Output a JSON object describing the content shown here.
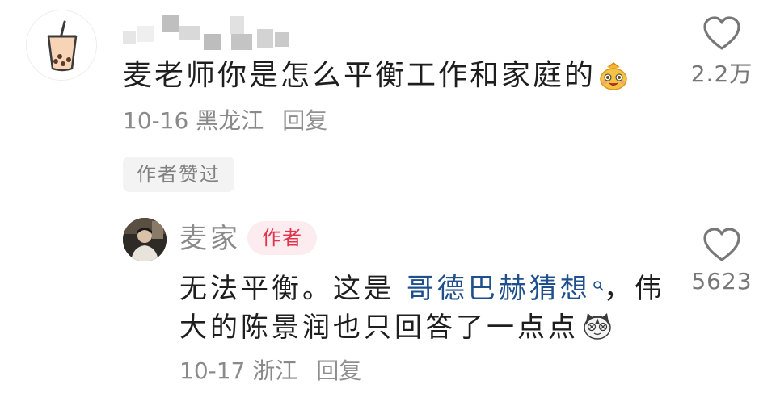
{
  "comment": {
    "text": "麦老师你是怎么平衡工作和家庭的",
    "emoji": "money-bag-emoji",
    "date": "10-16",
    "location": "黑龙江",
    "reply_label": "回复",
    "author_liked_label": "作者赞过",
    "like_count": "2.2万"
  },
  "reply": {
    "author_name": "麦家",
    "author_badge": "作者",
    "text_before": "无法平衡。这是 ",
    "topic_link": "哥德巴赫猜想",
    "text_after": "，伟",
    "line2": "大的陈景润也只回答了一点点",
    "emoji": "cat-face-emoji",
    "date": "10-17",
    "location": "浙江",
    "reply_label": "回复",
    "like_count": "5623"
  },
  "colors": {
    "text": "#1e1e1e",
    "meta": "#8a8a8a",
    "link": "#1f4f8c",
    "badge_text": "#e0334c",
    "badge_bg": "#fdecef",
    "tag_bg": "#f3f3f3"
  }
}
